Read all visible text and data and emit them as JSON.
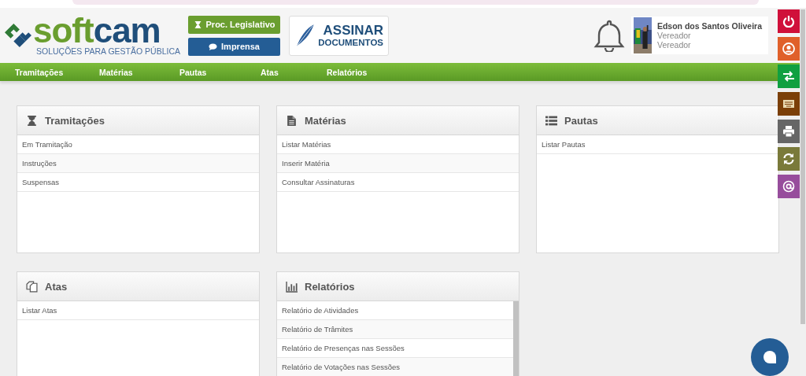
{
  "logo": {
    "name_part_1": "soft",
    "name_part_2": "cam",
    "tagline": "SOLUÇÕES PARA GESTÃO PÚBLICA"
  },
  "header_buttons": [
    {
      "label": "Proc. Legislativo",
      "color": "#6a9e2f"
    },
    {
      "label": "Imprensa",
      "color": "#245d95"
    }
  ],
  "sign_button": {
    "line_1": "ASSINAR",
    "line_2": "DOCUMENTOS"
  },
  "user": {
    "name": "Edson dos Santos Oliveira",
    "role": "Vereador",
    "position": "Vereador"
  },
  "nav": [
    "Tramitações",
    "Matérias",
    "Pautas",
    "Atas",
    "Relatórios"
  ],
  "panels": [
    {
      "title": "Tramitações",
      "items": [
        "Em Tramitação",
        "Instruções",
        "Suspensas"
      ]
    },
    {
      "title": "Matérias",
      "items": [
        "Listar Matérias",
        "Inserir Matéria",
        "Consultar Assinaturas"
      ]
    },
    {
      "title": "Pautas",
      "items": [
        "Listar Pautas"
      ]
    },
    {
      "title": "Atas",
      "items": [
        "Listar Atas"
      ]
    },
    {
      "title": "Relatórios",
      "items": [
        "Relatório de Atividades",
        "Relatório de Trâmites",
        "Relatório de Presenças nas Sessões",
        "Relatório de Votações nas Sessões"
      ]
    }
  ],
  "side_buttons": [
    {
      "color": "#d0103a"
    },
    {
      "color": "#e0602a"
    },
    {
      "color": "#10a040"
    },
    {
      "color": "#7b3f08"
    },
    {
      "color": "#666666"
    },
    {
      "color": "#7a7a3a"
    },
    {
      "color": "#974d9c"
    }
  ]
}
